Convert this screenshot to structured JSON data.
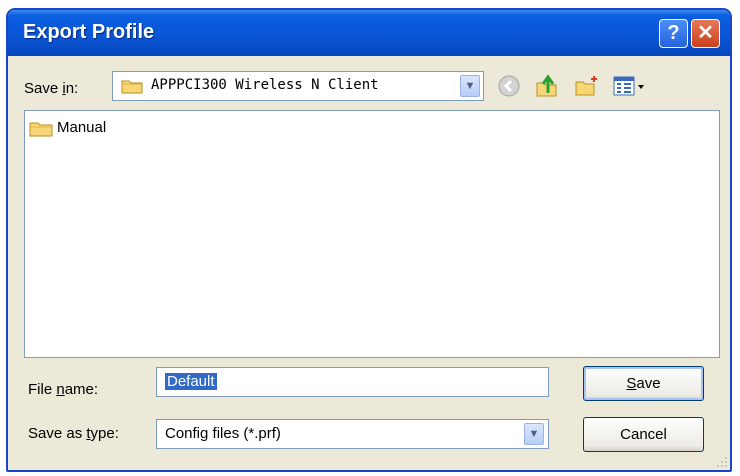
{
  "window": {
    "title": "Export Profile"
  },
  "titlebar_buttons": {
    "help": "?",
    "close": "✕"
  },
  "save_in": {
    "label_pre": "Save ",
    "label_key": "i",
    "label_post": "n:",
    "value": "APPPCI300 Wireless N Client",
    "icon": "folder-icon"
  },
  "toolbar": [
    "back-icon",
    "up-folder-icon",
    "new-folder-icon",
    "views-menu-icon"
  ],
  "files": [
    {
      "name": "Manual",
      "icon": "folder-icon"
    }
  ],
  "file_name": {
    "label_pre": "File ",
    "label_key": "n",
    "label_post": "ame:",
    "value": "Default"
  },
  "save_as_type": {
    "label_pre": "Save as ",
    "label_key": "t",
    "label_post": "ype:",
    "value": "Config files (*.prf)"
  },
  "buttons": {
    "save_key": "S",
    "save_rest": "ave",
    "cancel": "Cancel"
  },
  "colors": {
    "titlebar": "#0a55d6",
    "dialog_bg": "#ece9d8",
    "selection": "#3169c6",
    "close_button": "#c9401c"
  }
}
